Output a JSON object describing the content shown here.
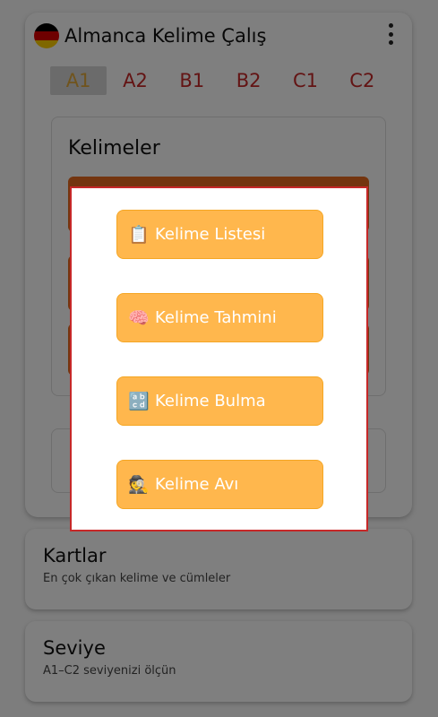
{
  "header": {
    "title": "Almanca Kelime Çalış"
  },
  "flag_colors": [
    "#000000",
    "#dd0000",
    "#ffce00"
  ],
  "levels": [
    "A1",
    "A2",
    "B1",
    "B2",
    "C1",
    "C2"
  ],
  "words_section": {
    "title": "Kelimeler"
  },
  "cards": [
    {
      "title": "Kartlar",
      "subtitle": "En çok çıkan kelime ve cümleler"
    },
    {
      "title": "Seviye",
      "subtitle": "A1–C2 seviyenizi ölçün"
    }
  ],
  "dialog": {
    "buttons": [
      {
        "icon": "clipboard-icon",
        "glyph": "📋",
        "label": "Kelime Listesi"
      },
      {
        "icon": "brain-icon",
        "glyph": "🧠",
        "label": "Kelime Tahmini"
      },
      {
        "icon": "abcd-icon",
        "glyph": "🔡",
        "label": "Kelime Bulma"
      },
      {
        "icon": "detective-icon",
        "glyph": "🕵",
        "label": "Kelime Avı"
      }
    ]
  },
  "colors": {
    "accent_orange": "#ffb74d",
    "dialog_border": "#c62828",
    "level_text": "#c62828",
    "bar_orange": "#e86b1f"
  }
}
